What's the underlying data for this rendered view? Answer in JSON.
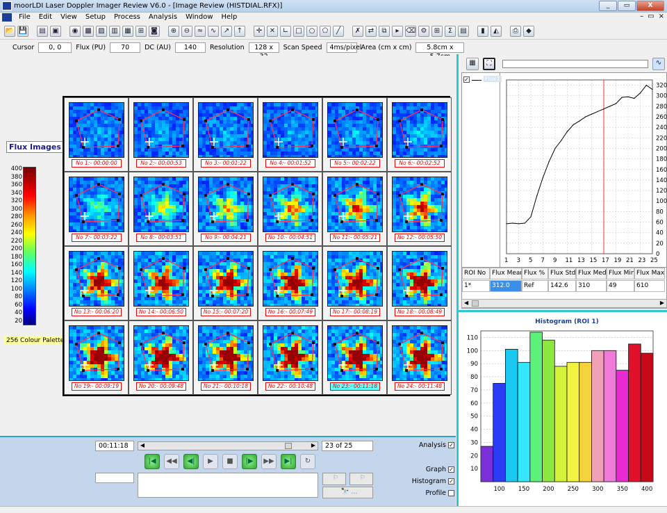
{
  "window": {
    "title": "moorLDI Laser Doppler Imager Review V6.0 - [Image Review (HISTDIAL.RFX)]",
    "buttons": {
      "min": "_",
      "max": "▭",
      "close": "X"
    }
  },
  "menu": [
    "File",
    "Edit",
    "View",
    "Setup",
    "Process",
    "Analysis",
    "Window",
    "Help"
  ],
  "mdi_buttons": {
    "min": "–",
    "max": "▭",
    "close": "×"
  },
  "toolbar_icons": [
    "open-icon",
    "save-icon",
    "stack-icon",
    "print-preview-icon",
    "palette-icon",
    "colour-image-icon",
    "photo-icon",
    "histogram-icon",
    "grid-icon",
    "fit-icon",
    "image-icon",
    "zoom-in-icon",
    "zoom-out-icon",
    "wave-icon",
    "wave2-icon",
    "trend-icon",
    "arrow-icon",
    "crosshair-icon",
    "cross-icon",
    "axis-icon",
    "rectangle-icon",
    "ellipse-icon",
    "polygon-icon",
    "line-icon",
    "delete-roi-icon",
    "roi-move-icon",
    "roi-copy-icon",
    "roi-select-icon",
    "roi-clear-icon",
    "roi-tools-icon",
    "roi-grid-icon",
    "roi-stats-icon",
    "report-icon",
    "bar-chart-icon",
    "area-chart-icon",
    "printer-icon",
    "book-icon"
  ],
  "status": {
    "cursor_label": "Cursor",
    "cursor_value": "0, 0",
    "flux_label": "Flux (PU)",
    "flux_value": "70",
    "dc_label": "DC (AU)",
    "dc_value": "140",
    "resolution_label": "Resolution",
    "resolution_value": "128 x 32",
    "scan_label": "Scan Speed",
    "scan_value": "4ms/pixel",
    "area_label": "Area (cm x cm)",
    "area_value": "5.8cm x 5.7cm"
  },
  "flux_images_label": "Flux Images",
  "palette": {
    "ticks": [
      "400",
      "380",
      "360",
      "340",
      "320",
      "300",
      "280",
      "260",
      "240",
      "220",
      "200",
      "180",
      "160",
      "140",
      "120",
      "100",
      "80",
      "60",
      "40",
      "20"
    ],
    "name": "256 Colour Palette 1"
  },
  "images": [
    {
      "label": "No 1:- 00:00:00",
      "level": 0.08
    },
    {
      "label": "No 2:- 00:00:53",
      "level": 0.08
    },
    {
      "label": "No 3:- 00:01:22",
      "level": 0.08
    },
    {
      "label": "No 4:- 00:01:52",
      "level": 0.08
    },
    {
      "label": "No 5:- 00:02:22",
      "level": 0.1
    },
    {
      "label": "No 6:- 00:02:52",
      "level": 0.12
    },
    {
      "label": "No 7:- 00:03:22",
      "level": 0.25
    },
    {
      "label": "No 8:- 00:03:51",
      "level": 0.35
    },
    {
      "label": "No 9:- 00:04:21",
      "level": 0.45
    },
    {
      "label": "No 10:- 00:04:51",
      "level": 0.5
    },
    {
      "label": "No 11:- 00:05:21",
      "level": 0.55
    },
    {
      "label": "No 12:- 00:05:50",
      "level": 0.6
    },
    {
      "label": "No 13:- 00:06:20",
      "level": 0.75
    },
    {
      "label": "No 14:- 00:06:50",
      "level": 0.78
    },
    {
      "label": "No 15:- 00:07:20",
      "level": 0.8
    },
    {
      "label": "No 16:- 00:07:49",
      "level": 0.82
    },
    {
      "label": "No 17:- 00:08:19",
      "level": 0.83
    },
    {
      "label": "No 18:- 00:08:49",
      "level": 0.84
    },
    {
      "label": "No 19:- 00:09:19",
      "level": 0.88
    },
    {
      "label": "No 20:- 00:09:48",
      "level": 0.9
    },
    {
      "label": "No 21:- 00:10:18",
      "level": 0.9
    },
    {
      "label": "No 22:- 00:10:48",
      "level": 0.92
    },
    {
      "label": "No 23:- 00:11:18",
      "level": 0.92,
      "selected": true
    },
    {
      "label": "No 24:- 00:11:48",
      "level": 0.93
    }
  ],
  "playback": {
    "time": "00:11:18",
    "position": "23 of 25",
    "slider_fraction": 0.88,
    "buttons": [
      "first-icon",
      "rewind-icon",
      "step-back-icon",
      "play-icon",
      "stop-icon",
      "step-forward-icon",
      "fast-forward-icon",
      "last-icon",
      "loop-icon"
    ],
    "glyphs": [
      "|◀",
      "◀◀",
      "◀|",
      "▶",
      "■",
      "|▶",
      "▶▶",
      "▶|",
      "↻"
    ],
    "browse": "🔭 ...",
    "arrow_left": "◀",
    "arrow_right": "▶"
  },
  "checks": [
    {
      "label": "Analysis",
      "checked": true
    },
    {
      "label": "Graph",
      "checked": true
    },
    {
      "label": "Histogram",
      "checked": true
    },
    {
      "label": "Profile",
      "checked": false
    }
  ],
  "graph": {
    "legend": "Flux1",
    "legend_checked": true,
    "toolbar_icons": [
      "table-icon",
      "fit-frame-icon",
      "waveform-icon"
    ]
  },
  "chart_data": [
    {
      "type": "line",
      "series": [
        {
          "name": "Flux1",
          "values": [
            57,
            58,
            57,
            58,
            70,
            110,
            145,
            175,
            200,
            215,
            232,
            245,
            252,
            260,
            265,
            270,
            275,
            280,
            285,
            297,
            298,
            295,
            305,
            320,
            312
          ]
        }
      ],
      "x": [
        1,
        2,
        3,
        4,
        5,
        6,
        7,
        8,
        9,
        10,
        11,
        12,
        13,
        14,
        15,
        16,
        17,
        18,
        19,
        20,
        21,
        22,
        23,
        24,
        25
      ],
      "xticks": [
        1,
        3,
        5,
        7,
        9,
        11,
        13,
        15,
        17,
        19,
        21,
        23,
        25
      ],
      "ylim": [
        0,
        330
      ],
      "yticks": [
        0,
        20,
        40,
        60,
        80,
        100,
        120,
        140,
        160,
        180,
        200,
        220,
        240,
        260,
        280,
        300,
        320
      ],
      "marker_x": 17,
      "grid": true
    },
    {
      "type": "bar",
      "title": "Histogram (ROI 1)",
      "categories": [
        "75",
        "100",
        "125",
        "150",
        "175",
        "200",
        "225",
        "250",
        "275",
        "300",
        "325",
        "350",
        "375",
        "400"
      ],
      "values": [
        27,
        75,
        101,
        91,
        114,
        108,
        88,
        91,
        91,
        100,
        100,
        85,
        105,
        98
      ],
      "colors": [
        "#7a2fd8",
        "#2b3cf5",
        "#19c9f2",
        "#35e6ff",
        "#5cf27a",
        "#8ce83e",
        "#d4f23a",
        "#f2f240",
        "#f5d23c",
        "#f2a0b8",
        "#f07ad8",
        "#e82bd2",
        "#e0102a",
        "#c80a18"
      ],
      "xticks": [
        100,
        150,
        200,
        250,
        300,
        350,
        400
      ],
      "ylim": [
        0,
        115
      ],
      "yticks": [
        10,
        20,
        30,
        40,
        50,
        60,
        70,
        80,
        90,
        100,
        110
      ],
      "grid": true
    }
  ],
  "stats": {
    "headers": [
      "ROI No",
      "Flux Mean",
      "Flux %",
      "Flux Std",
      "Flux Median",
      "Flux Min",
      "Flux Max"
    ],
    "rows": [
      [
        "1*",
        "312.0",
        "Ref",
        "142.6",
        "310",
        "49",
        "610"
      ]
    ]
  }
}
